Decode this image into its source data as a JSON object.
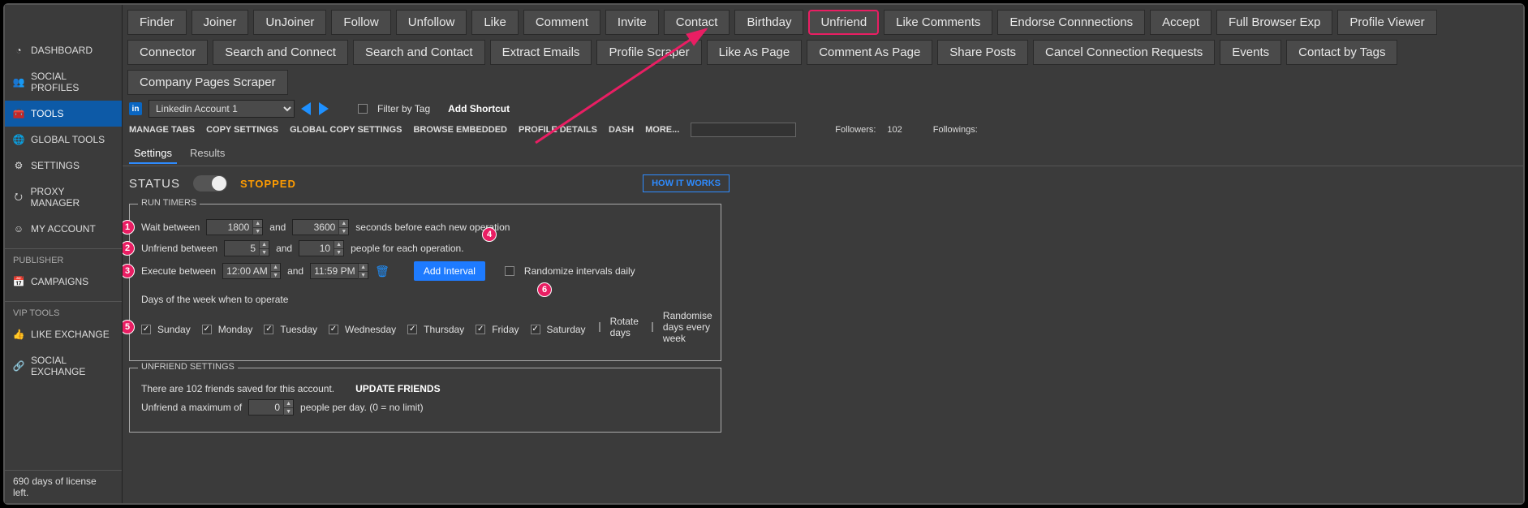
{
  "sidebar": {
    "items": [
      {
        "icon": "◔",
        "label": "DASHBOARD"
      },
      {
        "icon": "👥",
        "label": "SOCIAL PROFILES"
      },
      {
        "icon": "🧰",
        "label": "TOOLS"
      },
      {
        "icon": "🌐",
        "label": "GLOBAL TOOLS"
      },
      {
        "icon": "⚙",
        "label": "SETTINGS"
      },
      {
        "icon": "⭮",
        "label": "PROXY MANAGER"
      },
      {
        "icon": "☺",
        "label": "MY ACCOUNT"
      }
    ],
    "publisher_header": "PUBLISHER",
    "publisher_items": [
      {
        "icon": "📅",
        "label": "CAMPAIGNS"
      }
    ],
    "vip_header": "VIP TOOLS",
    "vip_items": [
      {
        "icon": "👍",
        "label": "LIKE EXCHANGE"
      },
      {
        "icon": "🔗",
        "label": "SOCIAL EXCHANGE"
      }
    ],
    "footer": "690 days of license left."
  },
  "toptabs": [
    "Finder",
    "Joiner",
    "UnJoiner",
    "Follow",
    "Unfollow",
    "Like",
    "Comment",
    "Invite",
    "Contact",
    "Birthday",
    "Unfriend",
    "Like Comments",
    "Endorse Connnections",
    "Accept",
    "Full Browser Exp",
    "Profile Viewer",
    "Connector",
    "Search and Connect",
    "Search and Contact",
    "Extract Emails",
    "Profile Scraper",
    "Like As Page",
    "Comment As Page",
    "Share Posts",
    "Cancel Connection Requests",
    "Events",
    "Contact by Tags",
    "Company Pages Scraper"
  ],
  "active_toptab": "Unfriend",
  "account": {
    "selected": "Linkedin Account 1",
    "filter_label": "Filter by Tag",
    "add_shortcut": "Add Shortcut"
  },
  "menubar": [
    "MANAGE TABS",
    "COPY SETTINGS",
    "GLOBAL COPY SETTINGS",
    "BROWSE EMBEDDED",
    "PROFILE DETAILS",
    "DASH",
    "MORE..."
  ],
  "followers_label": "Followers:",
  "followers_value": "102",
  "followings_label": "Followings:",
  "subtabs": {
    "settings": "Settings",
    "results": "Results"
  },
  "status": {
    "label": "STATUS",
    "value": "STOPPED",
    "howit": "HOW IT WORKS"
  },
  "runtimers": {
    "legend": "RUN TIMERS",
    "wait_label": "Wait between",
    "wait_min": "1800",
    "and": "and",
    "wait_max": "3600",
    "wait_after": "seconds before each new operation",
    "unf_label": "Unfriend between",
    "unf_min": "5",
    "unf_max": "10",
    "unf_after": "people for each operation.",
    "exec_label": "Execute between",
    "exec_from": "12:00 AM",
    "exec_to": "11:59 PM",
    "add_interval": "Add Interval",
    "randomize": "Randomize intervals daily",
    "days_header": "Days of the week when to operate",
    "days": [
      "Sunday",
      "Monday",
      "Tuesday",
      "Wednesday",
      "Thursday",
      "Friday",
      "Saturday"
    ],
    "rotate": "Rotate days",
    "randomise_days": "Randomise days every week"
  },
  "unfset": {
    "legend": "UNFRIEND SETTINGS",
    "saved_text": "There are 102 friends saved for this account.",
    "update": "UPDATE FRIENDS",
    "max_label": "Unfriend a maximum of",
    "max_value": "0",
    "max_after": "people per day. (0 = no limit)"
  },
  "callouts": {
    "c1": "1",
    "c2": "2",
    "c3": "3",
    "c4": "4",
    "c5": "5",
    "c6": "6"
  }
}
